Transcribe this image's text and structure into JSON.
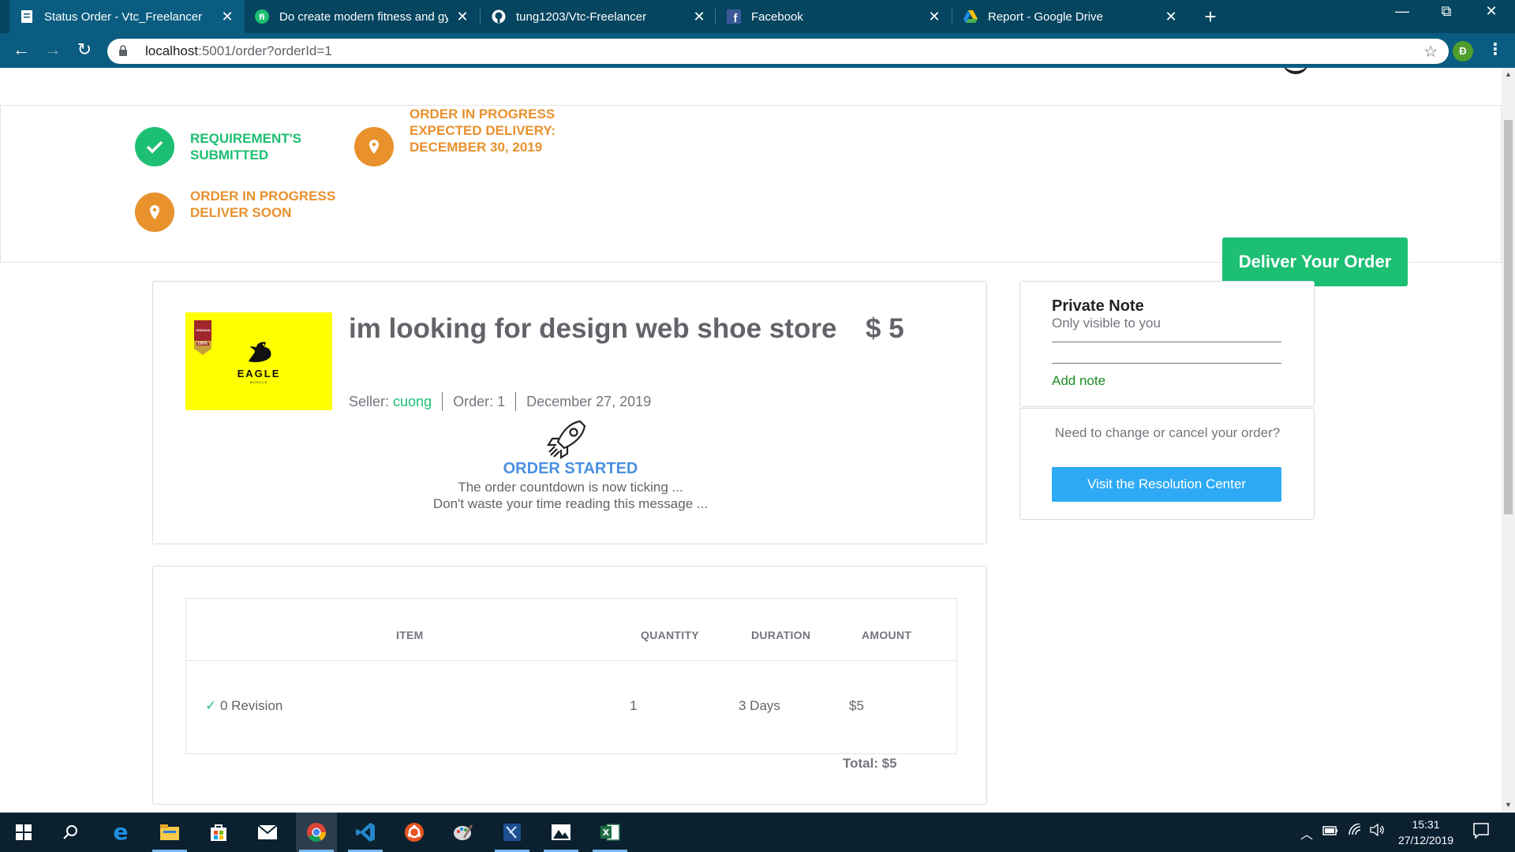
{
  "browser": {
    "tabs": [
      {
        "title": "Status Order - Vtc_Freelancer",
        "icon": "document-icon",
        "active": true
      },
      {
        "title": "Do create modern fitness and gym",
        "icon": "fiverr-icon",
        "active": false
      },
      {
        "title": "tung1203/Vtc-Freelancer",
        "icon": "github-icon",
        "active": false
      },
      {
        "title": "Facebook",
        "icon": "facebook-icon",
        "active": false
      },
      {
        "title": "Report - Google Drive",
        "icon": "google-drive-icon",
        "active": false
      }
    ],
    "url_host": "localhost",
    "url_rest": ":5001/order?orderId=1",
    "profile_initial": "Đ"
  },
  "status": {
    "steps": [
      {
        "label": "REQUIREMENT'S SUBMITTED",
        "state": "complete",
        "icon": "check-icon"
      },
      {
        "label": "ORDER IN PROGRESS EXPECTED DELIVERY: December 30, 2019",
        "state": "in-progress",
        "icon": "location-pin-icon"
      },
      {
        "label": "ORDER IN PROGRESS DELIVER SOON",
        "state": "in-progress",
        "icon": "location-pin-icon"
      }
    ],
    "deliver_button": "Deliver Your Order"
  },
  "order": {
    "thumbnail_brand": "EAGLE",
    "thumbnail_sub": "MUSCLE",
    "badge_top": "ORIGINAL",
    "badge_bottom": "100%",
    "title": "im looking for design web shoe store",
    "price": "$ 5",
    "seller_label": "Seller:",
    "seller_name": "cuong",
    "order_label": "Order: 1",
    "date": "December 27, 2019",
    "started_title": "ORDER STARTED",
    "started_line1": "The order countdown is now ticking ...",
    "started_line2": "Don't waste your time reading this message ..."
  },
  "private_note": {
    "title": "Private Note",
    "subtitle": "Only visible to you",
    "add_note": "Add note"
  },
  "resolution": {
    "text": "Need to change or cancel your order?",
    "button": "Visit the Resolution Center"
  },
  "items_table": {
    "headers": [
      "ITEM",
      "QUANTITY",
      "DURATION",
      "AMOUNT"
    ],
    "rows": [
      {
        "check": "✓",
        "item": "0 Revision",
        "quantity": "1",
        "duration": "3 Days",
        "amount": "$5"
      }
    ],
    "total": "Total: $5"
  },
  "taskbar": {
    "time": "15:31",
    "date": "27/12/2019"
  },
  "colors": {
    "tabbar": "#054560",
    "toolbar": "#0a5d80",
    "green": "#1dbf73",
    "orange": "#e8912d",
    "blue_link": "#4a90e2",
    "resolution_btn": "#2eaaf4",
    "thumbnail_bg": "#ffff00"
  }
}
